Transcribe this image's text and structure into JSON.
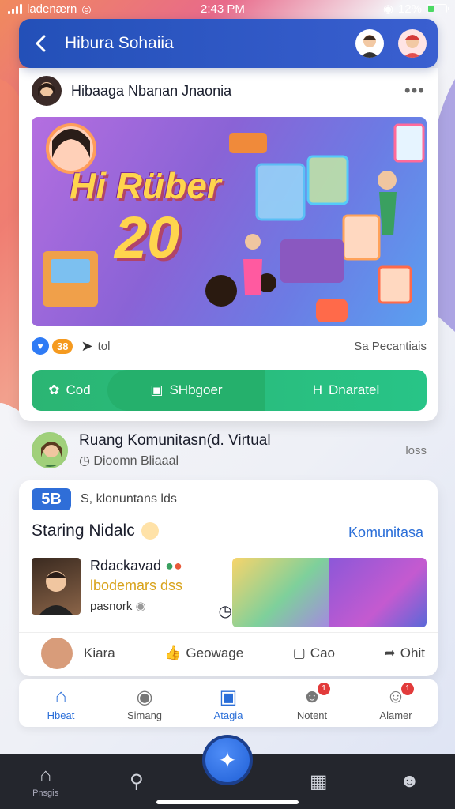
{
  "status_bar": {
    "carrier": "ladenærn",
    "time": "2:43 PM",
    "battery": "12%"
  },
  "app_bar": {
    "title": "Hibura Sohaiia"
  },
  "post": {
    "author": "Hibaaga Nbanan Jnaonia",
    "banner_text": "Hi Rüber",
    "banner_number": "20",
    "reaction_count": "38",
    "share_count": "tol",
    "meta_right": "Sa Pecantiais",
    "actions": {
      "like": "Cod",
      "comment": "SHbgoer",
      "share": "Dnaratel"
    }
  },
  "community": {
    "title": "Ruang Komunitasn(d. Virtual",
    "subtitle": "Dioomn Bliaaal",
    "right": "loss"
  },
  "card2": {
    "logo": "5B",
    "head_text": "S, klonuntans lds",
    "title": "Staring Nidalc",
    "link": "Komunitasa",
    "feature": {
      "title": "Rdackavad",
      "subtitle": "lbodemars dss",
      "footer": "pasnork"
    },
    "actions": {
      "profile": "Kiara",
      "like": "Geowage",
      "comment": "Cao",
      "share": "Ohit"
    }
  },
  "tab_bar": [
    {
      "label": "Hbeat",
      "icon": "home-icon"
    },
    {
      "label": "Simang",
      "icon": "chat-icon"
    },
    {
      "label": "Atagia",
      "icon": "grid-icon"
    },
    {
      "label": "Notent",
      "icon": "people-icon",
      "badge": "1"
    },
    {
      "label": "Alamer",
      "icon": "profile-icon",
      "badge": "1"
    }
  ],
  "sys_nav": {
    "first_label": "Pnsgis"
  },
  "colors": {
    "primary": "#2350b8",
    "action_green": "#2bb573",
    "link_blue": "#2a6ed8",
    "badge_red": "#e23b3b"
  }
}
